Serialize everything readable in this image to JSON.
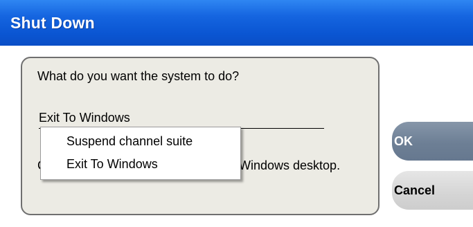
{
  "window": {
    "title": "Shut Down",
    "titlebar_color": "#0a55d2"
  },
  "dialog": {
    "prompt": "What do you want the system to do?",
    "selected_option": "Exit To Windows",
    "options": [
      "Suspend channel suite",
      "Exit To Windows"
    ],
    "description_prefix": "C",
    "description_suffix": "Windows desktop."
  },
  "buttons": {
    "ok_label": "OK",
    "cancel_label": "Cancel"
  },
  "colors": {
    "panel_bg": "#ecebe4",
    "ok_bg": "#6d7f95",
    "cancel_bg": "#d5d5d5"
  }
}
